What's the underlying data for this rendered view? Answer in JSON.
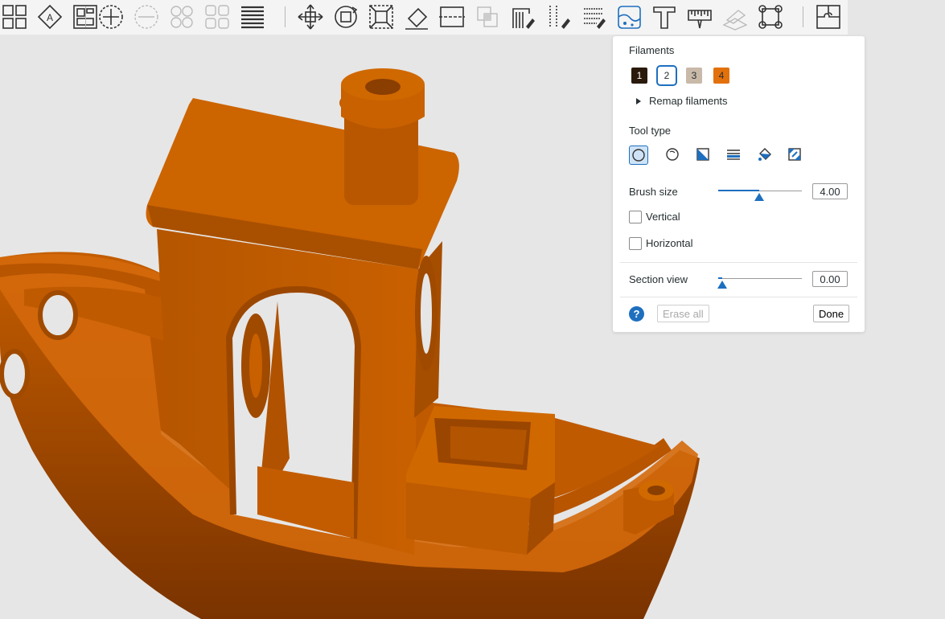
{
  "toolbar": {
    "groups": [
      [
        "arrange-icon",
        "orient-icon",
        "layout-icon"
      ],
      [
        "add-plate-icon",
        "remove-plate-icon",
        "split-objects-icon",
        "split-parts-icon",
        "variable-layer-icon"
      ],
      [
        "move-icon",
        "rotate-icon",
        "scale-icon",
        "lay-on-face-icon",
        "cut-icon",
        "boolean-icon",
        "support-paint-icon",
        "seam-paint-icon",
        "fuzzy-skin-icon",
        "color-paint-icon",
        "text-icon",
        "measure-icon",
        "assembly-icon",
        "brim-ears-icon"
      ],
      [
        "assembly-view-icon"
      ]
    ],
    "active_tool": "color-paint-icon"
  },
  "panel": {
    "filaments_label": "Filaments",
    "filaments": [
      {
        "num": "1",
        "color": "#2a1a0c",
        "text_color": "#ffffff"
      },
      {
        "num": "2",
        "color": "#ffffff",
        "text_color": "#262e30",
        "selected": true
      },
      {
        "num": "3",
        "color": "#c9b9a8",
        "text_color": "#262e30"
      },
      {
        "num": "4",
        "color": "#e3710b",
        "text_color": "#262e30"
      }
    ],
    "remap_label": "Remap filaments",
    "tool_type_label": "Tool type",
    "tools": [
      "circle-brush-icon",
      "sphere-brush-icon",
      "triangle-fill-icon",
      "height-range-icon",
      "fill-bucket-icon",
      "gap-fill-icon"
    ],
    "brush_size_label": "Brush size",
    "brush_size_value": "4.00",
    "brush_size_fraction": 0.49,
    "vertical_label": "Vertical",
    "horizontal_label": "Horizontal",
    "section_view_label": "Section view",
    "section_view_value": "0.00",
    "section_view_fraction": 0.05,
    "help_label": "?",
    "erase_all_label": "Erase all",
    "done_label": "Done"
  },
  "colors": {
    "accent": "#1e6fbf",
    "model": "#c95f00",
    "viewport_bg": "#e6e6e6"
  }
}
